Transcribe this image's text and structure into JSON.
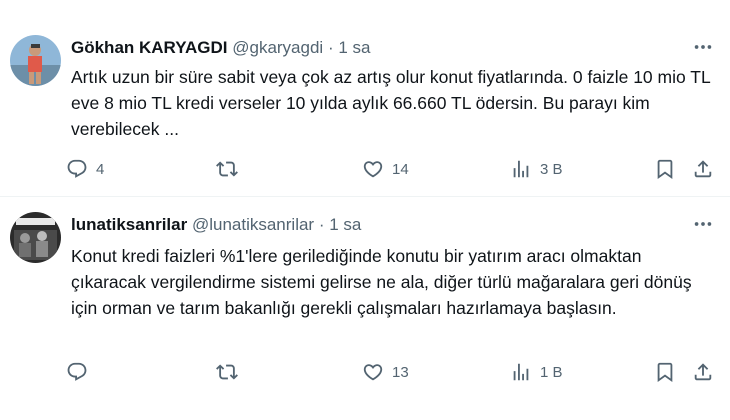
{
  "tweets": [
    {
      "name": "Gökhan KARYAGDI",
      "handle": "@gkaryagdi",
      "separator": "·",
      "time": "1 sa",
      "text": "Artık uzun bir süre sabit veya çok az artış olur konut fiyatlarında. 0 faizle 10 mio TL eve 8 mio TL kredi verseler 10 yılda aylık 66.660 TL ödersin. Bu parayı kim verebilecek ...",
      "replies": "4",
      "retweets": "",
      "likes": "14",
      "views": "3 B",
      "avatar_bg": "#8fb7d8"
    },
    {
      "name": "lunatiksanrilar",
      "handle": "@lunatiksanrilar",
      "separator": "·",
      "time": "1 sa",
      "text": "Konut kredi faizleri %1'lere gerilediğinde konutu bir yatırım aracı olmaktan çıkaracak vergilendirme sistemi gelirse ne ala, diğer türlü mağaralara geri dönüş için orman ve tarım bakanlığı gerekli çalışmaları hazırlamaya başlasın.",
      "replies": "",
      "retweets": "",
      "likes": "13",
      "views": "1 B",
      "avatar_bg": "#2b2b2b"
    }
  ],
  "icons": [
    "reply-icon",
    "retweet-icon",
    "like-icon",
    "views-icon",
    "bookmark-icon",
    "share-icon",
    "more-icon"
  ],
  "colors": {
    "text": "#0f1419",
    "secondary": "#536471",
    "divider": "#eff3f4"
  }
}
